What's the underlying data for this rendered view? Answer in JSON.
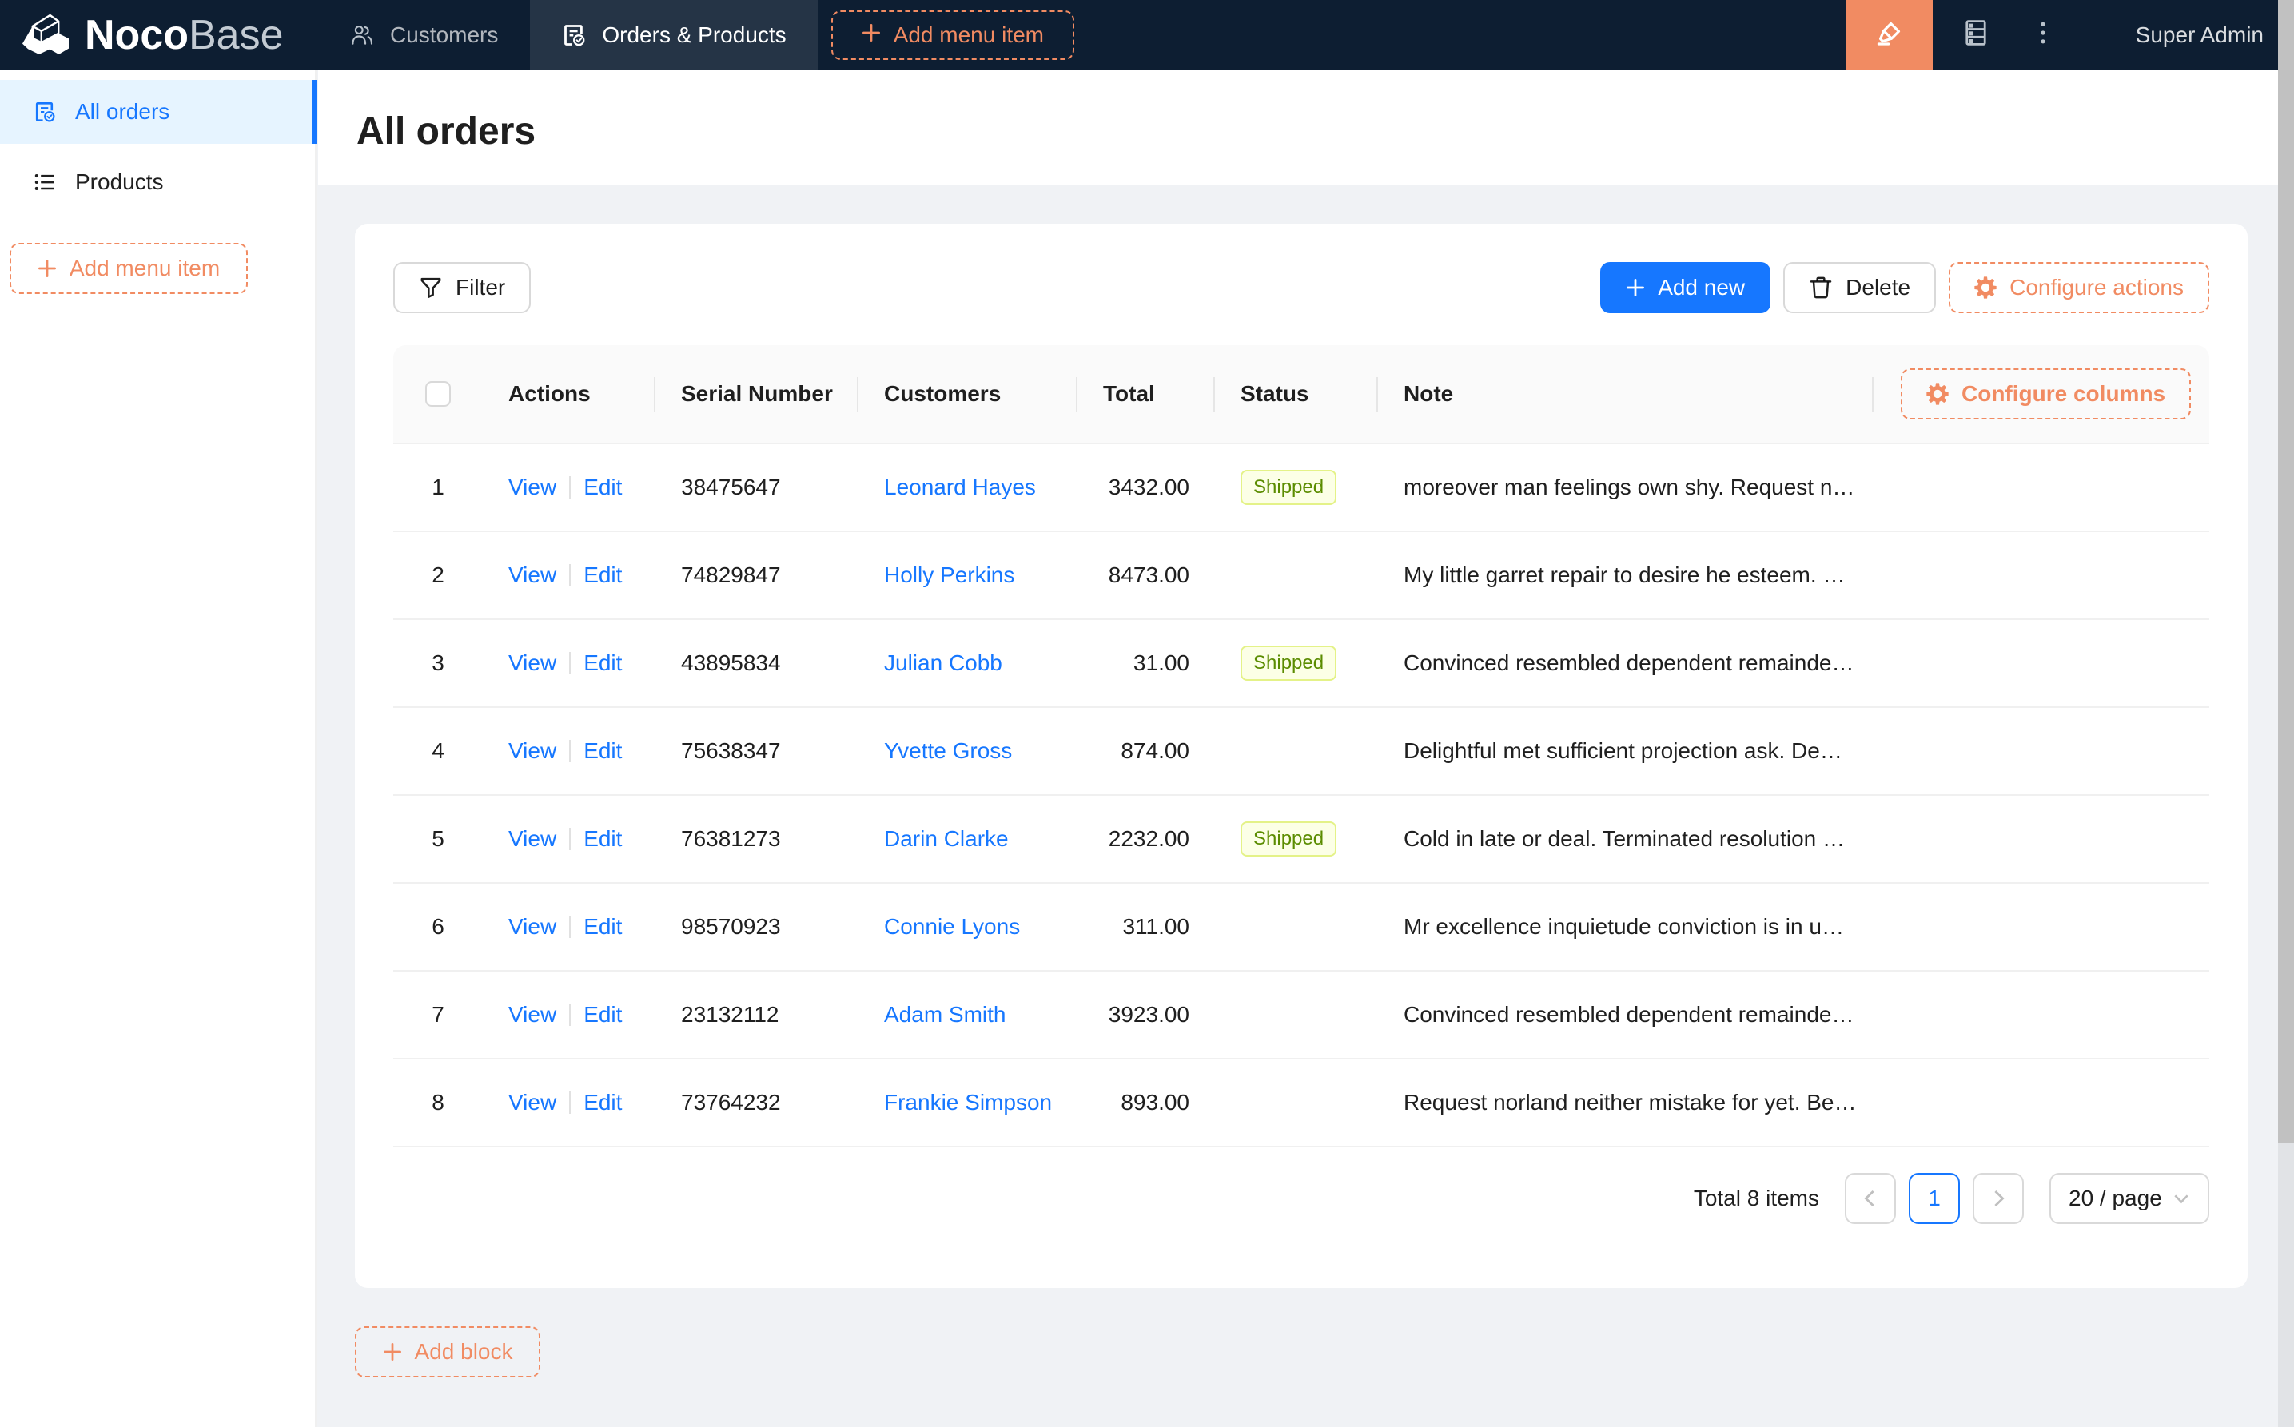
{
  "brand": {
    "name_bold": "Noco",
    "name_light": "Base"
  },
  "navbar": {
    "tabs": [
      {
        "label": "Customers",
        "icon": "team-icon",
        "active": false
      },
      {
        "label": "Orders & Products",
        "icon": "file-done-icon",
        "active": true
      }
    ],
    "add_menu_item_label": "Add menu item",
    "user": "Super Admin"
  },
  "sidebar": {
    "items": [
      {
        "label": "All orders",
        "icon": "file-done-icon",
        "active": true
      },
      {
        "label": "Products",
        "icon": "unordered-list-icon",
        "active": false
      }
    ],
    "add_menu_item_label": "Add menu item"
  },
  "page": {
    "title": "All orders"
  },
  "toolbar": {
    "filter_label": "Filter",
    "add_new_label": "Add new",
    "delete_label": "Delete",
    "configure_actions_label": "Configure actions"
  },
  "table": {
    "configure_columns_label": "Configure columns",
    "columns": {
      "actions": "Actions",
      "serial": "Serial Number",
      "customers": "Customers",
      "total": "Total",
      "status": "Status",
      "note": "Note"
    },
    "action_labels": {
      "view": "View",
      "edit": "Edit"
    },
    "rows": [
      {
        "index": "1",
        "serial": "38475647",
        "customer": "Leonard Hayes",
        "total": "3432.00",
        "status": "Shipped",
        "note": "moreover man feelings own shy. Request n…"
      },
      {
        "index": "2",
        "serial": "74829847",
        "customer": "Holly Perkins",
        "total": "8473.00",
        "status": "",
        "note": "My little garret repair to desire he esteem. …"
      },
      {
        "index": "3",
        "serial": "43895834",
        "customer": "Julian Cobb",
        "total": "31.00",
        "status": "Shipped",
        "note": "Convinced resembled dependent remainde…"
      },
      {
        "index": "4",
        "serial": "75638347",
        "customer": "Yvette Gross",
        "total": "874.00",
        "status": "",
        "note": "Delightful met sufficient projection ask. De…"
      },
      {
        "index": "5",
        "serial": "76381273",
        "customer": "Darin Clarke",
        "total": "2232.00",
        "status": "Shipped",
        "note": "Cold in late or deal. Terminated resolution …"
      },
      {
        "index": "6",
        "serial": "98570923",
        "customer": "Connie Lyons",
        "total": "311.00",
        "status": "",
        "note": "Mr excellence inquietude conviction is in u…"
      },
      {
        "index": "7",
        "serial": "23132112",
        "customer": "Adam Smith",
        "total": "3923.00",
        "status": "",
        "note": "Convinced resembled dependent remainde…"
      },
      {
        "index": "8",
        "serial": "73764232",
        "customer": "Frankie Simpson",
        "total": "893.00",
        "status": "",
        "note": "Request norland neither mistake for yet. Be…"
      }
    ]
  },
  "pagination": {
    "total_text": "Total 8 items",
    "current_page": "1",
    "page_size_label": "20 / page"
  },
  "add_block_label": "Add block",
  "colors": {
    "primary": "#1677ff",
    "designer_orange": "#f18b62",
    "navbar_bg": "#0d1e32",
    "tag_bg": "#fcffe6",
    "tag_border": "#e4f288",
    "tag_text": "#5b8c00",
    "selected_menu_bg": "#e6f4ff"
  }
}
